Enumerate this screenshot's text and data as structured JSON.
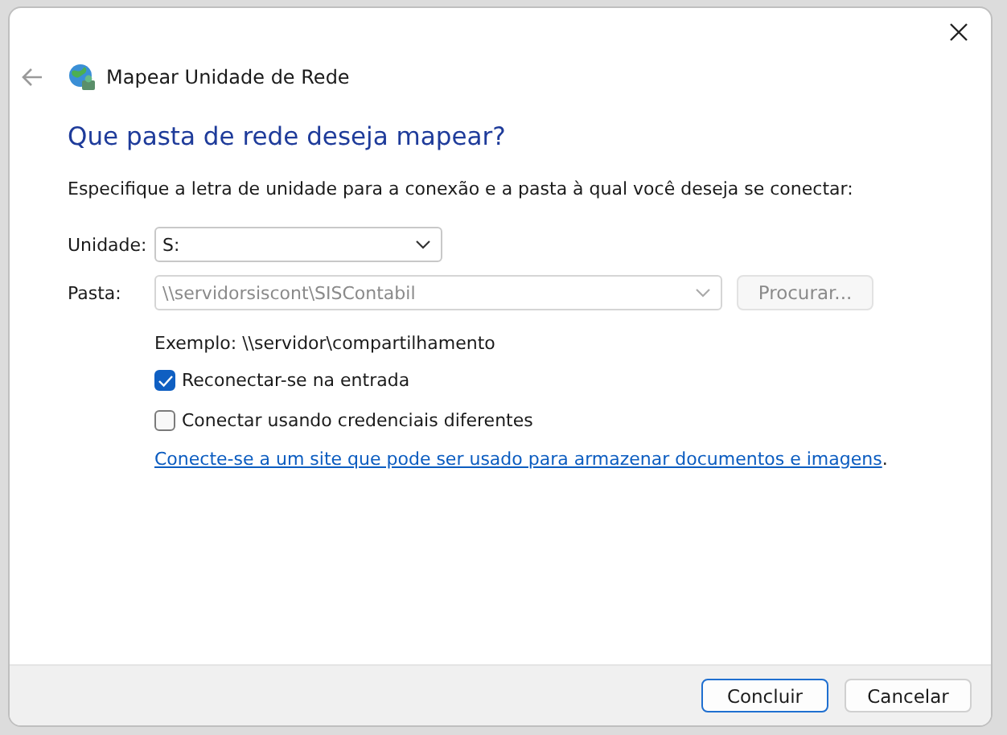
{
  "window": {
    "title": "Mapear Unidade de Rede",
    "back_disabled": true
  },
  "heading": "Que pasta de rede deseja mapear?",
  "instructions": "Especifique a letra de unidade para a conexão e a pasta à qual você deseja se conectar:",
  "fields": [
    {
      "label": "Unidade:",
      "value": "S:",
      "disabled": false
    },
    {
      "label": "Pasta:",
      "value": "\\\\servidorsiscont\\SISContabil",
      "disabled": true
    }
  ],
  "browse_button": {
    "label": "Procurar...",
    "disabled": true
  },
  "example": "Exemplo: \\\\servidor\\compartilhamento",
  "checkboxes": [
    {
      "label": "Reconectar-se na entrada",
      "checked": true
    },
    {
      "label": "Conectar usando credenciais diferentes",
      "checked": false
    }
  ],
  "link": {
    "text": "Conecte-se a um site que pode ser usado para armazenar documentos e imagens",
    "suffix": "."
  },
  "buttons": [
    {
      "label": "Concluir",
      "default": true
    },
    {
      "label": "Cancelar",
      "default": false
    }
  ]
}
